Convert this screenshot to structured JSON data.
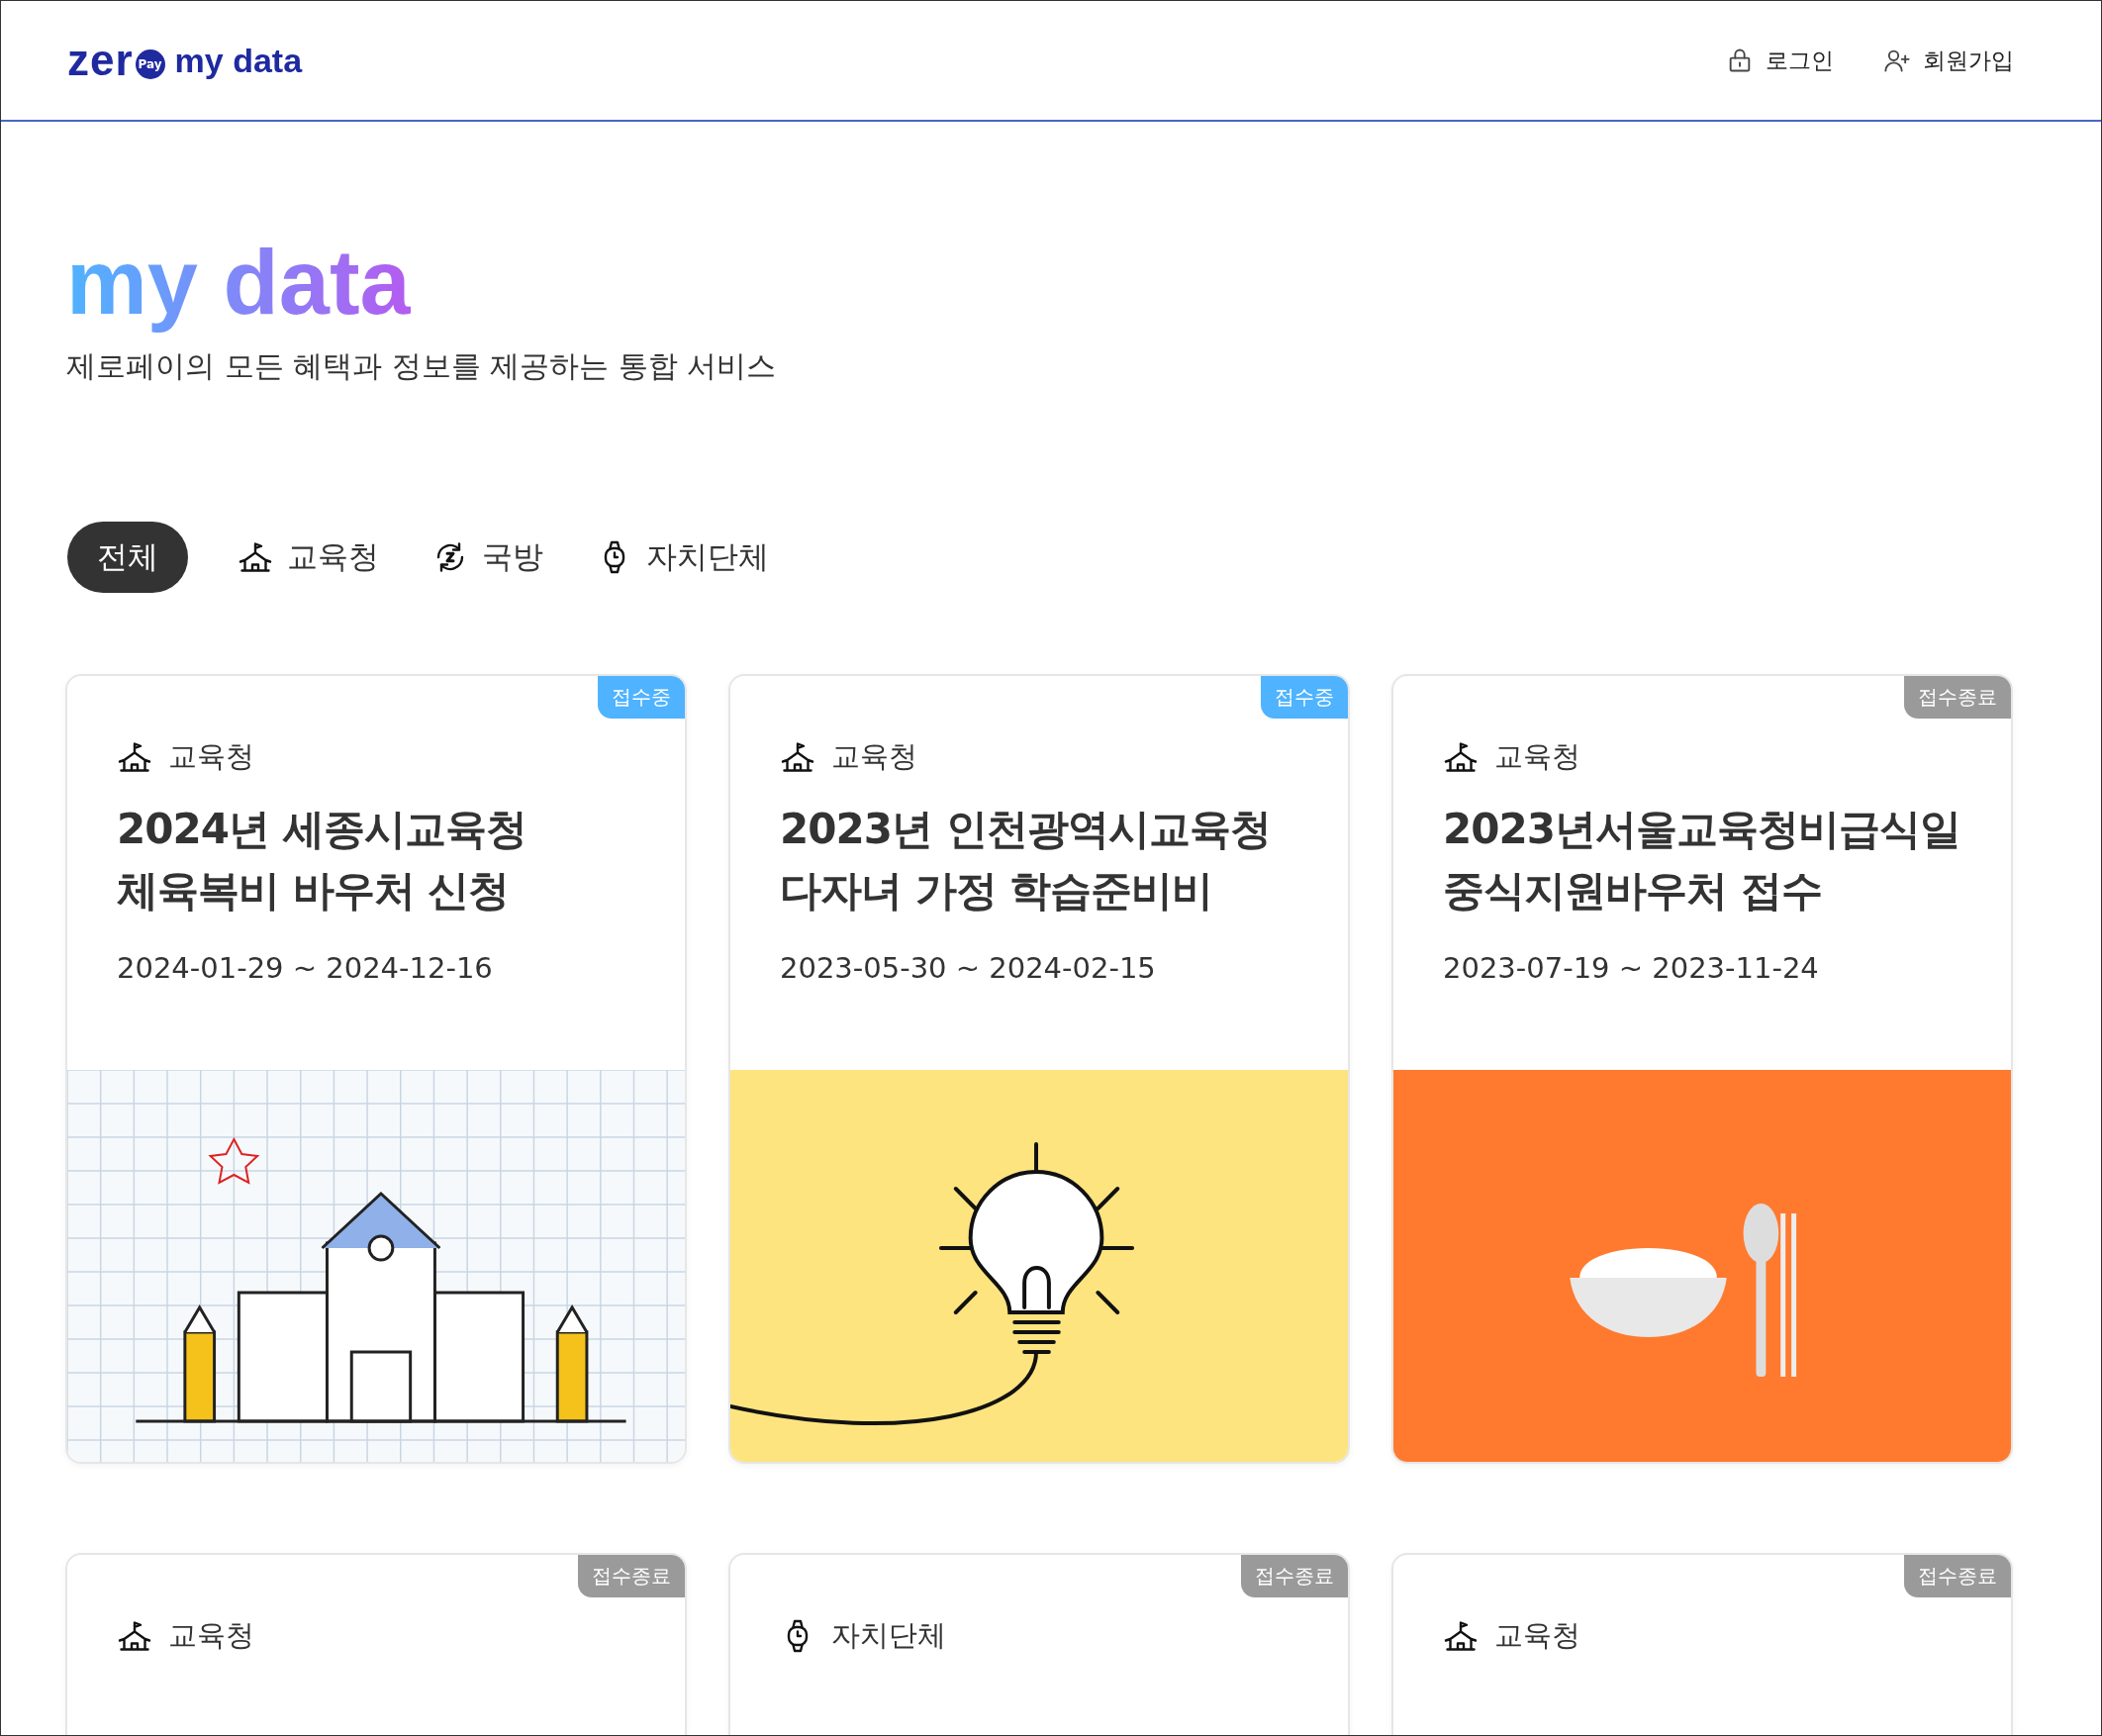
{
  "header": {
    "logo": {
      "word": "zer",
      "badge": "Pay",
      "product": "my data"
    },
    "links": [
      {
        "kind": "login",
        "label": "로그인"
      },
      {
        "kind": "signup",
        "label": "회원가입"
      }
    ]
  },
  "hero": {
    "title": "my data",
    "subtitle": "제로페이의 모든 혜택과 정보를 제공하는 통합 서비스"
  },
  "tabs": [
    {
      "kind": "all",
      "label": "전체",
      "selected": true
    },
    {
      "kind": "education",
      "label": "교육청",
      "selected": false
    },
    {
      "kind": "defense",
      "label": "국방",
      "selected": false
    },
    {
      "kind": "local",
      "label": "자치단체",
      "selected": false
    }
  ],
  "cards": [
    {
      "open": true,
      "badge": "접수중",
      "category": {
        "kind": "education",
        "label": "교육청"
      },
      "title": "2024년 세종시교육청 체육복비 바우처 신청",
      "dates": "2024-01-29 ~ 2024-12-16",
      "picture": {
        "kind": "school"
      }
    },
    {
      "open": true,
      "badge": "접수중",
      "category": {
        "kind": "education",
        "label": "교육청"
      },
      "title": "2023년 인천광역시교육청 다자녀 가정 학습준비비",
      "dates": "2023-05-30 ~ 2024-02-15",
      "picture": {
        "kind": "bulb"
      }
    },
    {
      "open": false,
      "badge": "접수종료",
      "category": {
        "kind": "education",
        "label": "교육청"
      },
      "title": "2023년서울교육청비급식일중식지원바우처 접수",
      "dates": "2023-07-19 ~ 2023-11-24",
      "picture": {
        "kind": "meal"
      }
    },
    {
      "open": false,
      "badge": "접수종료",
      "category": {
        "kind": "education",
        "label": "교육청"
      }
    },
    {
      "open": false,
      "badge": "접수종료",
      "category": {
        "kind": "local",
        "label": "자치단체"
      }
    },
    {
      "open": false,
      "badge": "접수종료",
      "category": {
        "kind": "education",
        "label": "교육청"
      }
    }
  ]
}
